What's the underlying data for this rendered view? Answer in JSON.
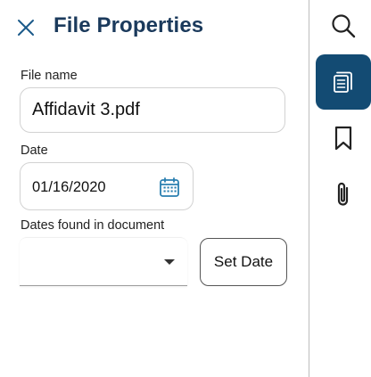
{
  "header": {
    "title": "File Properties",
    "close_icon": "close-icon"
  },
  "form": {
    "file_name": {
      "label": "File name",
      "value": "Affidavit 3.pdf"
    },
    "date": {
      "label": "Date",
      "value": "01/16/2020",
      "icon": "calendar-icon"
    },
    "dates_found": {
      "label": "Dates found in document",
      "selected": "",
      "icon": "dropdown-arrow-icon"
    },
    "set_date_label": "Set Date"
  },
  "rail": {
    "items": [
      {
        "icon": "search-icon",
        "active": false
      },
      {
        "icon": "document-properties-icon",
        "active": true
      },
      {
        "icon": "bookmark-icon",
        "active": false
      },
      {
        "icon": "paperclip-icon",
        "active": false
      }
    ]
  },
  "colors": {
    "accent": "#134b73",
    "title": "#1b3a5c",
    "calendar": "#2a7fb0"
  }
}
